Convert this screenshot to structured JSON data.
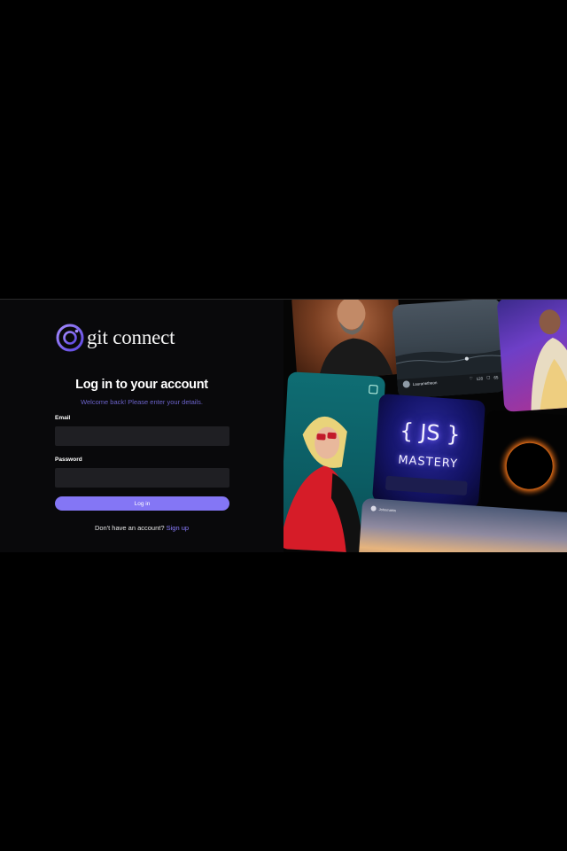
{
  "brand": {
    "name": "git connect",
    "accent": "#8476f5"
  },
  "login": {
    "title": "Log in to your account",
    "subtitle": "Welcome back! Please enter your details.",
    "email_label": "Email",
    "email_value": "",
    "password_label": "Password",
    "password_value": "",
    "submit_label": "Log in",
    "signup_prompt": "Don't have an account?",
    "signup_link": "Sign up"
  },
  "collage": {
    "post_card": {
      "username": "Lauranetheon",
      "likes": "120",
      "comments": "65"
    },
    "js_mastery": {
      "brace_text": "{ JS }",
      "word": "MASTERY"
    },
    "sunset_card": {
      "username": "Johnmahin"
    }
  }
}
